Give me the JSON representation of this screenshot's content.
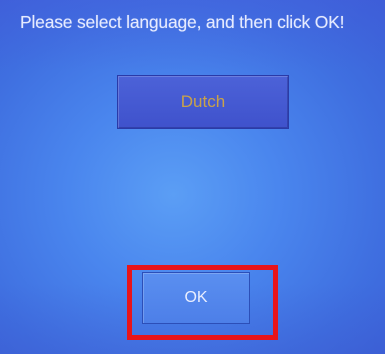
{
  "dialog": {
    "prompt": "Please select language, and then click OK!",
    "language_button_label": "Dutch",
    "ok_button_label": "OK"
  },
  "colors": {
    "background": "#4a86ee",
    "language_label": "#c9a24a",
    "highlight_border": "#e8141a",
    "text": "#e6ebff"
  }
}
